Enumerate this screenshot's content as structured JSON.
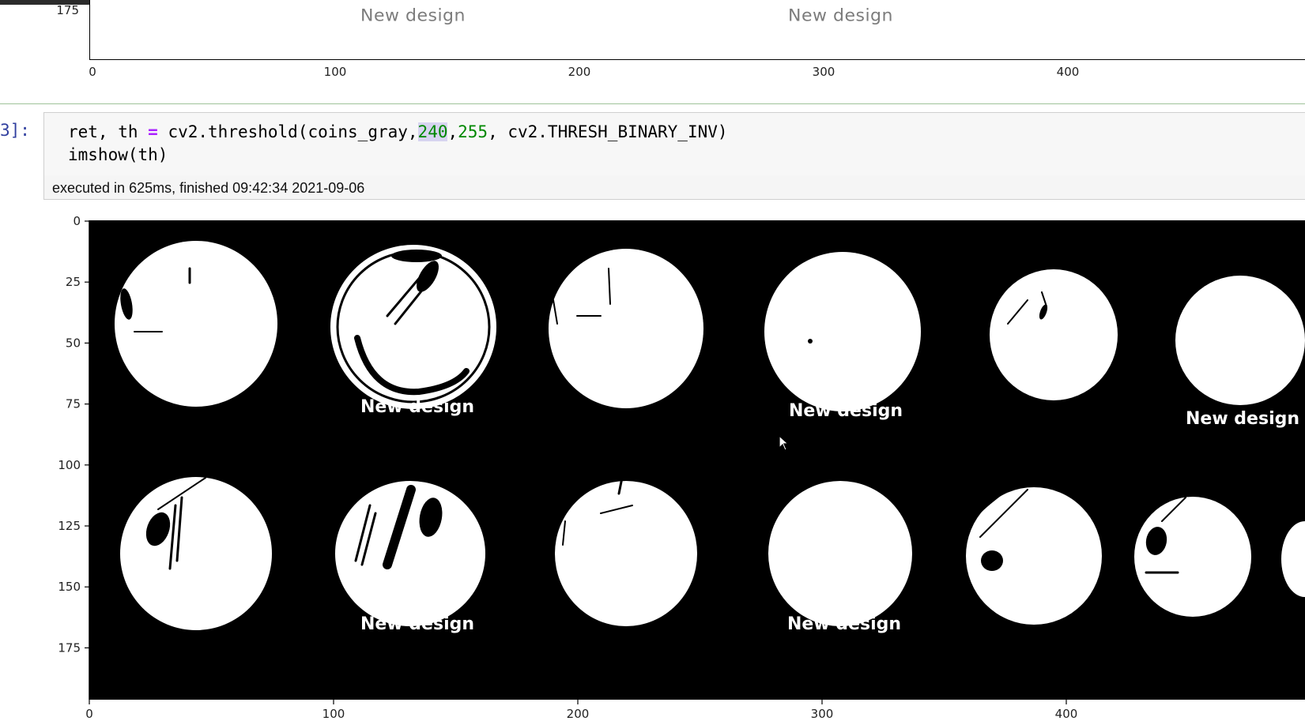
{
  "previous_output": {
    "ytick_label": "175",
    "xtick_labels": [
      "0",
      "100",
      "200",
      "300",
      "400"
    ],
    "image_text": [
      "New design",
      "New design"
    ]
  },
  "cell": {
    "prompt": "3]:",
    "code": {
      "line1": {
        "before_op": "ret, th ",
        "op": "=",
        "call": " cv2.threshold(coins_gray,",
        "thresh": "240",
        "comma": ",",
        "maxval": "255",
        "rest": ", cv2.THRESH_BINARY_INV)"
      },
      "line2": "imshow(th)"
    },
    "execution_status": "executed in 625ms, finished 09:42:34 2021-09-06"
  },
  "output_image": {
    "ytick_labels": [
      "0",
      "25",
      "50",
      "75",
      "100",
      "125",
      "150",
      "175"
    ],
    "xtick_labels": [
      "0",
      "100",
      "200",
      "300",
      "400"
    ],
    "image_text": [
      "New design",
      "New design",
      "New design",
      "New design",
      "New design"
    ],
    "background_color": "#000000",
    "foreground_color": "#ffffff"
  }
}
